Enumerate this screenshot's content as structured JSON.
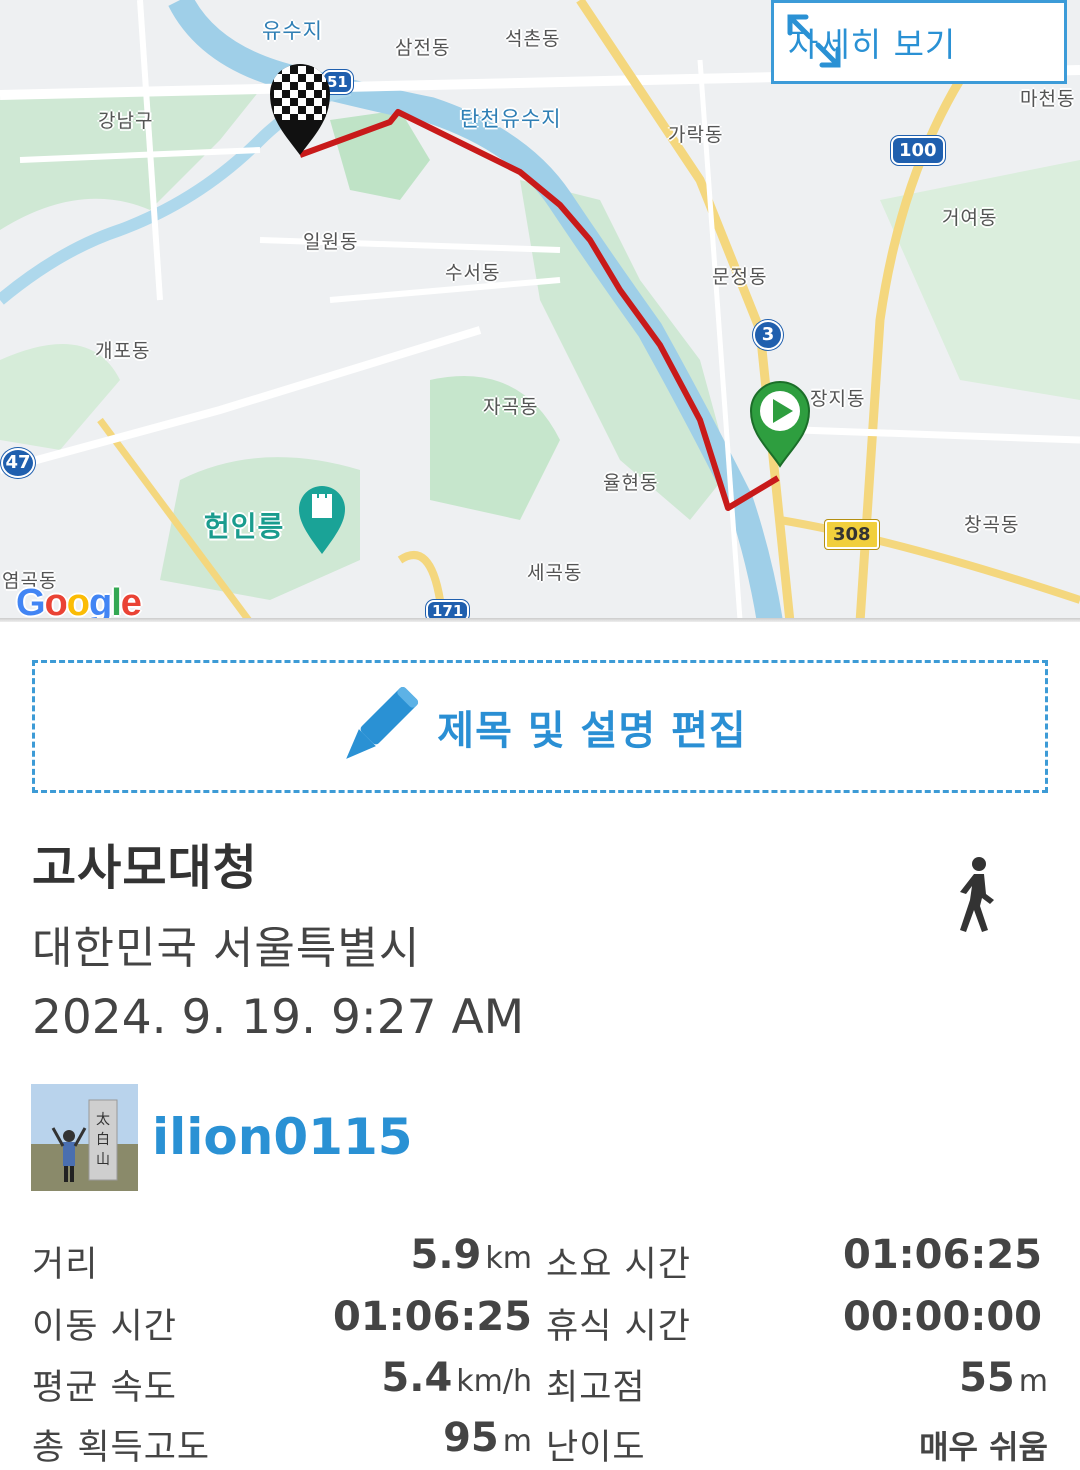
{
  "map": {
    "expand_label": "자세히 보기",
    "google_logo": "Google",
    "places": [
      {
        "text": "유수지",
        "kind": "water"
      },
      {
        "text": "삼전동",
        "kind": "area"
      },
      {
        "text": "석촌동",
        "kind": "area"
      },
      {
        "text": "강남구",
        "kind": "area"
      },
      {
        "text": "탄천유수지",
        "kind": "water"
      },
      {
        "text": "가락동",
        "kind": "area"
      },
      {
        "text": "마천동",
        "kind": "area"
      },
      {
        "text": "일원동",
        "kind": "area"
      },
      {
        "text": "수서동",
        "kind": "area"
      },
      {
        "text": "거여동",
        "kind": "area"
      },
      {
        "text": "문정동",
        "kind": "area"
      },
      {
        "text": "개포동",
        "kind": "area"
      },
      {
        "text": "장지동",
        "kind": "area"
      },
      {
        "text": "자곡동",
        "kind": "area"
      },
      {
        "text": "율현동",
        "kind": "area"
      },
      {
        "text": "헌인릉",
        "kind": "poi"
      },
      {
        "text": "창곡동",
        "kind": "area"
      },
      {
        "text": "세곡동",
        "kind": "area"
      },
      {
        "text": "염곡동",
        "kind": "area"
      }
    ],
    "road_shields": [
      "51",
      "100",
      "3",
      "47",
      "308",
      "171"
    ],
    "route_color": "#c81a1a",
    "start_marker_color": "#2e9e3f",
    "finish_marker": "checkered-flag"
  },
  "edit": {
    "label": "제목 및 설명 편집",
    "icon": "pencil-icon"
  },
  "record": {
    "title": "고사모대청",
    "location": "대한민국 서울특별시",
    "datetime": "2024. 9. 19. 9:27 AM",
    "activity_icon": "walking-icon",
    "username": "ilion0115"
  },
  "stats": {
    "distance": {
      "label": "거리",
      "value": "5.9",
      "unit": "km"
    },
    "duration": {
      "label": "소요 시간",
      "value": "01:06:25",
      "unit": ""
    },
    "moving_time": {
      "label": "이동 시간",
      "value": "01:06:25",
      "unit": ""
    },
    "rest_time": {
      "label": "휴식 시간",
      "value": "00:00:00",
      "unit": ""
    },
    "avg_speed": {
      "label": "평균 속도",
      "value": "5.4",
      "unit": "km/h"
    },
    "max_altitude": {
      "label": "최고점",
      "value": "55",
      "unit": "m"
    },
    "total_ascent": {
      "label": "총 획득고도",
      "value": "95",
      "unit": "m"
    },
    "difficulty": {
      "label": "난이도",
      "value": "매우 쉬움",
      "unit": ""
    }
  },
  "colors": {
    "accent": "#2a91d4",
    "dash_border": "#3d9bd6",
    "text": "#444444"
  }
}
